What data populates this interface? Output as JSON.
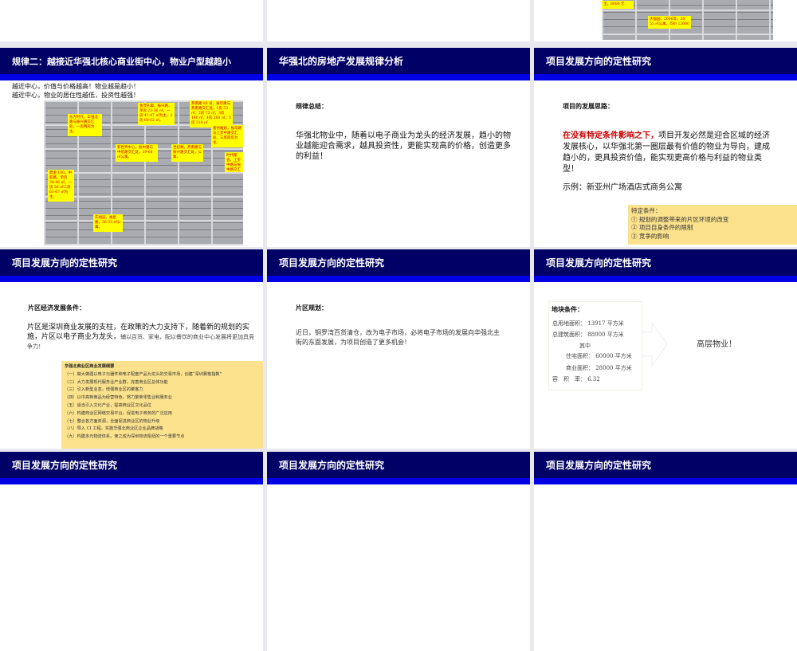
{
  "slides": {
    "top_right": {
      "callouts": [
        "庆福园，2006年，36-55 ㎡公寓，均价 12000",
        "宝，8000 元"
      ]
    },
    "r1c1": {
      "title": "规律二：越接近华强北核心商业街中心，物业户型越趋小",
      "lines": [
        "越近中心，价值与价格越高！物业越是趋小！",
        "越近中心，物业的居住性越低，投资性越强！"
      ],
      "callouts": [
        "东方时代，华强北路与振兴路交汇处，一房两房为主。",
        "金茂礼都，振兴路，单房 23-36 ㎡，一房 41-47 ㎡为主，2房 60-62 ㎡。",
        "燕南路 86 号，振华路与燕南路交汇处，1房 53 ㎡，2房 73 ㎡，3房 140 ㎡，4房 200 ㎡，5房 218 ㎡",
        "新世界中心，振中路与中航路交汇处，39-66 ㎡公寓。",
        "世纪阁，燕南路与振兴路交汇处，公寓。",
        "嘉怡雅居，振华路与上步中路交汇处，三房四房为主。",
        "时代都会，上步中路与振中路交汇处，一房 46 ㎡，两房 77-80 ㎡。",
        "鼎金 100，中航路，单房 30-46 ㎡，一房 56 ㎡二房 61-67 ㎡为主。",
        "庆福园，福星路，36-55 ㎡公寓。"
      ]
    },
    "r1c2": {
      "title": "华强北的房地产发展规律分析",
      "label": "规律总结：",
      "body": "华强北物业中，随着以电子商业为龙头的经济发展，趋小的物业越能迎合需求，越具投资性，更能实现高的价格，创造更多的利益！"
    },
    "r1c3": {
      "title": "项目发展方向的定性研究",
      "label": "项目的发展思路：",
      "highlight": "在没有特定条件影响之下，",
      "body": "项目开发必然是迎合区域的经济发展核心，以华强北第一圈层最有价值的物业为导向，建成趋小的，更具投资价值，能实现更高价格与利益的物业类型！",
      "example": "示例：新亚州广场酒店式商务公寓",
      "note": [
        "特定条件：",
        "① 规划的调整带来的片区环境的改变",
        "② 项目自身条件的限制",
        "③ 竞争的影响"
      ]
    },
    "r2c1": {
      "title": "项目发展方向的定性研究",
      "label": "片区经济发展条件：",
      "body_a": "片区是深圳商业发展的支柱，在政策的大力支持下，随着新的规划的实施，片区以电子商业为龙头，",
      "body_b": "辅以百货、家电，配以餐饮的商业中心发展将更加具竞争力！",
      "note_title": "华强北商业区商业发展纲要",
      "note": [
        "（一）做大做强以电子元器件和电子配套产品为龙头的交易市场，创建“深圳赛格指数”",
        "（二）大力发展现代服务业产业群，完善商业区总体功能",
        "（三）引入新型业态，增强商业区的聚客力",
        "（四）以中高档商品为经营特色，努力繁荣零售业和服务业",
        "（五）适当引入文化产业，提高商业区文化品位",
        "（六）构建商业区网络交易平台，促进电子商务的广泛应用",
        "（七）整合各方面资源，全面促进商业区的物业升级",
        "（八）导入 CI 工程，实施华强北商业区企业品牌战略",
        "（九）构建多元物流体系，使之成为深圳物流枢纽的一个重要节点"
      ]
    },
    "r2c2": {
      "title": "项目发展方向的定性研究",
      "label": "片区规划：",
      "body": "近日，铜罗湾百货清仓，改为电子市场，必将电子市场的发展向华强北主街的东面发展，为项目创造了更多机会！"
    },
    "r2c3": {
      "title": "项目发展方向的定性研究",
      "label": "地块条件：",
      "rows": [
        "总用地面积： 13917 平方米",
        "总建筑面积： 88000 平方米",
        "其中",
        "住宅面积： 60000 平方米",
        "商业面积： 28000 平方米",
        "容　积　率： 6.32"
      ],
      "result": "高层物业！"
    },
    "r3c1": {
      "title": "项目发展方向的定性研究"
    },
    "r3c2": {
      "title": "项目发展方向的定性研究"
    },
    "r3c3": {
      "title": "项目发展方向的定性研究"
    }
  },
  "colors": {
    "header": "#000066",
    "strip": "#0000e6",
    "highlight": "#cc0000",
    "note": "#fce28c"
  }
}
